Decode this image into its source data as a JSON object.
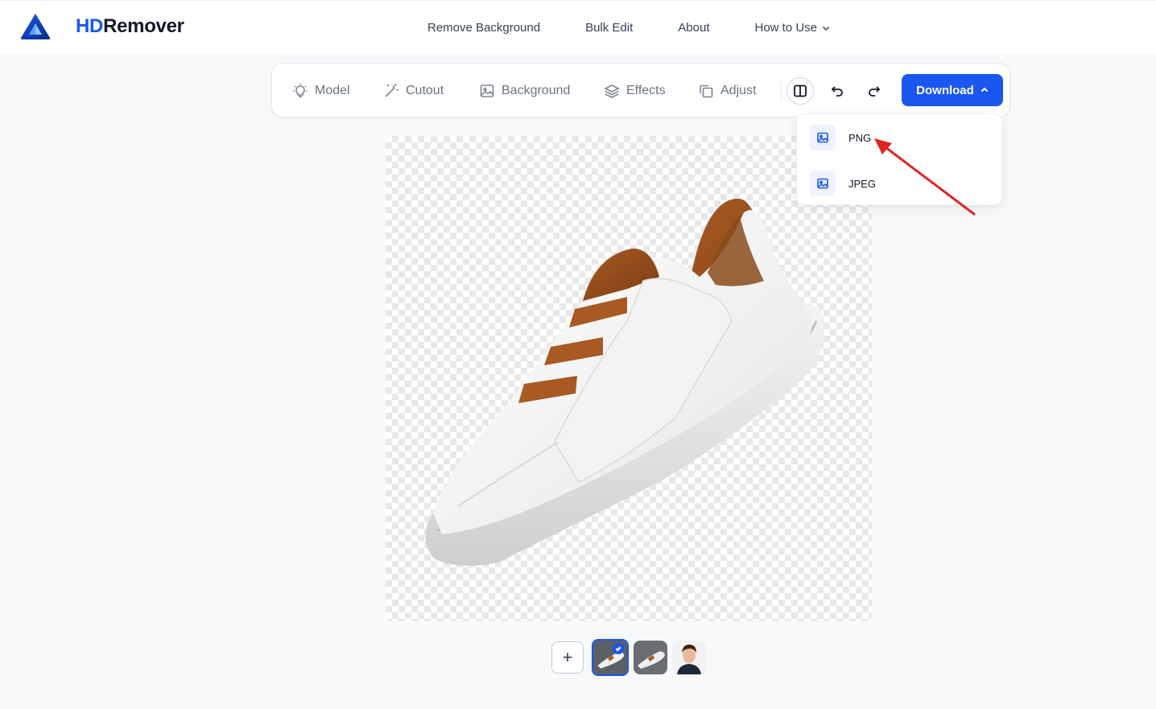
{
  "header": {
    "brand_prefix": "HD",
    "brand_suffix": "Remover",
    "nav": [
      {
        "label": "Remove Background"
      },
      {
        "label": "Bulk Edit"
      },
      {
        "label": "About"
      },
      {
        "label": "How to Use"
      }
    ]
  },
  "toolbar": {
    "tools": [
      {
        "label": "Model",
        "icon": "lightbulb-icon"
      },
      {
        "label": "Cutout",
        "icon": "magic-wand-icon"
      },
      {
        "label": "Background",
        "icon": "image-icon"
      },
      {
        "label": "Effects",
        "icon": "layers-icon"
      },
      {
        "label": "Adjust",
        "icon": "copy-icon"
      }
    ],
    "download_label": "Download"
  },
  "download_menu": {
    "items": [
      {
        "label": "PNG",
        "icon": "image-icon"
      },
      {
        "label": "JPEG",
        "icon": "image-icon"
      }
    ]
  },
  "thumbnails": {
    "add_label": "+",
    "items": [
      {
        "subject": "shoe",
        "selected": true
      },
      {
        "subject": "shoe",
        "selected": false
      },
      {
        "subject": "person",
        "selected": false
      }
    ]
  },
  "colors": {
    "accent": "#1a56f0",
    "annotation_arrow": "#e02424"
  }
}
